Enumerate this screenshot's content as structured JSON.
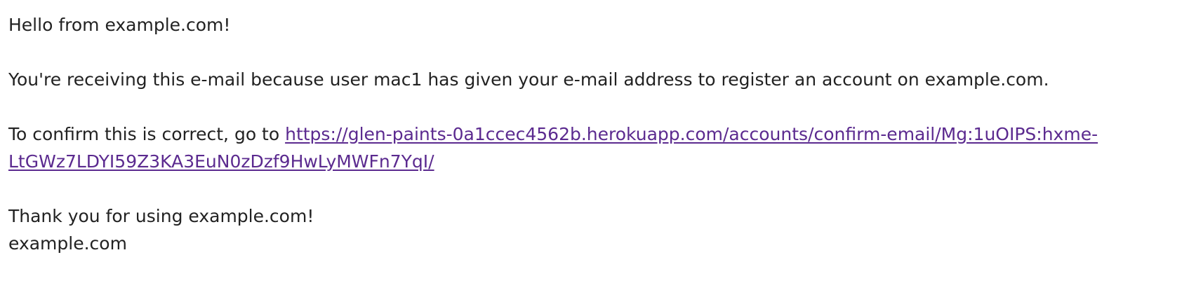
{
  "email": {
    "greeting": "Hello from example.com!",
    "message": "You're receiving this e-mail because user mac1 has given your e-mail address to register an account on example.com.",
    "confirm_prefix": "To confirm this is correct, go to ",
    "confirm_link_line1": "https://glen-paints-0a1ccec4562b.herokuapp.com/accounts/confirm-email/Mg:1uOIPS:hxme-",
    "confirm_link_line2": "LtGWz7LDYI59Z3KA3EuN0zDzf9HwLyMWFn7YqI/",
    "thanks": "Thank you for using example.com!",
    "signature": "example.com"
  },
  "colors": {
    "text": "#222222",
    "link": "#5b2a8f",
    "background": "#ffffff"
  }
}
